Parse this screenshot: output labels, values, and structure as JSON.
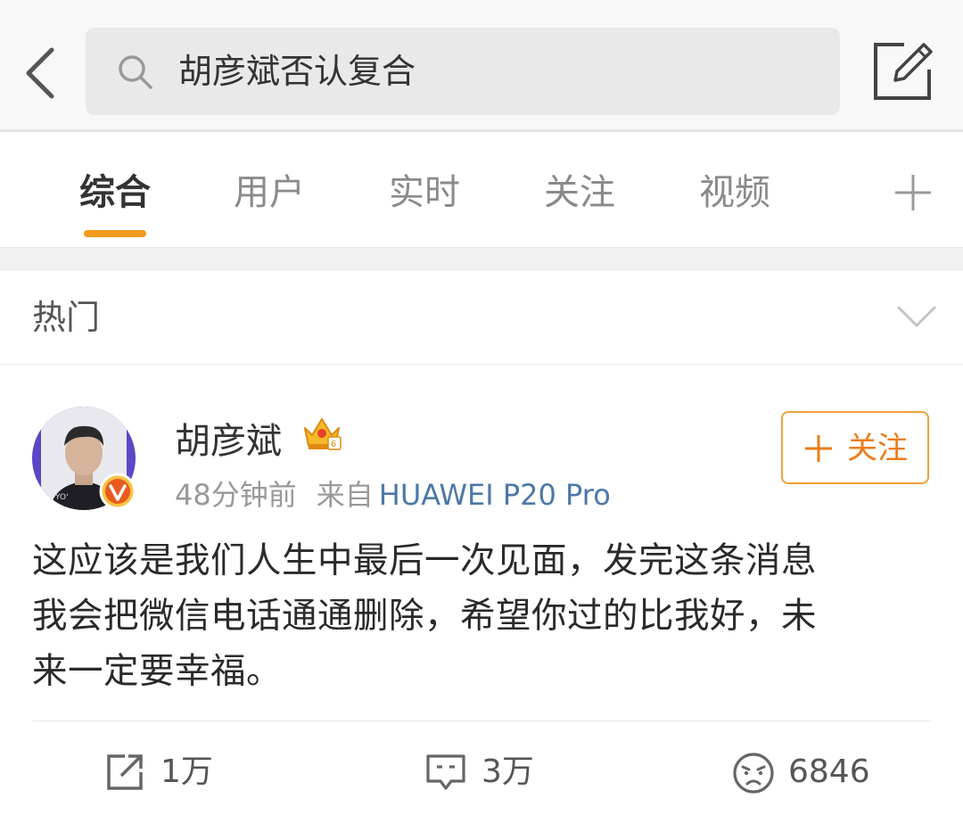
{
  "search": {
    "query": "胡彦斌否认复合"
  },
  "tabs": [
    {
      "label": "综合",
      "active": true
    },
    {
      "label": "用户",
      "active": false
    },
    {
      "label": "实时",
      "active": false
    },
    {
      "label": "关注",
      "active": false
    },
    {
      "label": "视频",
      "active": false
    }
  ],
  "section": {
    "title": "热门"
  },
  "post": {
    "username": "胡彦斌",
    "time": "48分钟前",
    "source_label": "来自",
    "device": "HUAWEI P20 Pro",
    "follow_label": "关注",
    "text_lines": [
      "这应该是我们人生中最后一次见面，发完这条消息",
      "我会把微信电话通通删除，希望你过的比我好，未",
      "来一定要幸福。"
    ],
    "reposts": "1万",
    "comments": "3万",
    "likes": "6846"
  },
  "icons": {
    "back": "chevron-left-icon",
    "search": "search-icon",
    "compose": "compose-icon",
    "add_tab": "plus-icon",
    "expand": "chevron-down-icon",
    "verified": "verified-v-icon",
    "member": "crown-icon",
    "repost": "repost-icon",
    "comment": "comment-icon",
    "like": "emoji-icon"
  },
  "colors": {
    "accent": "#f39a1e",
    "follow_border": "#f0a236",
    "follow_text": "#eb7c17",
    "link": "#4c78a8",
    "verified_badge": "#e8a317"
  }
}
